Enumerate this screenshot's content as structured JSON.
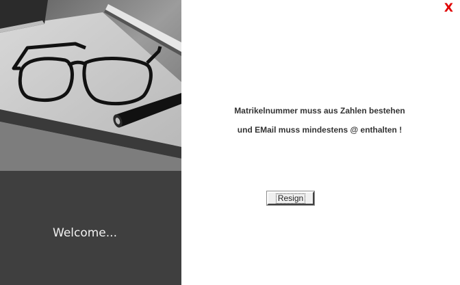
{
  "sidebar": {
    "image_description": "black-and-white desk photo",
    "welcome_text": "Welcome..."
  },
  "window": {
    "close_label": "X"
  },
  "dialog": {
    "message_line1": "Matrikelnummer muss aus Zahlen bestehen",
    "message_line2": "und EMail muss mindestens @ enthalten !",
    "resign_label": "Resign"
  },
  "colors": {
    "close": "#e00000",
    "sidebar_bg": "#3f3f3f",
    "welcome_text": "#f2f2f2",
    "message_text": "#333333"
  }
}
